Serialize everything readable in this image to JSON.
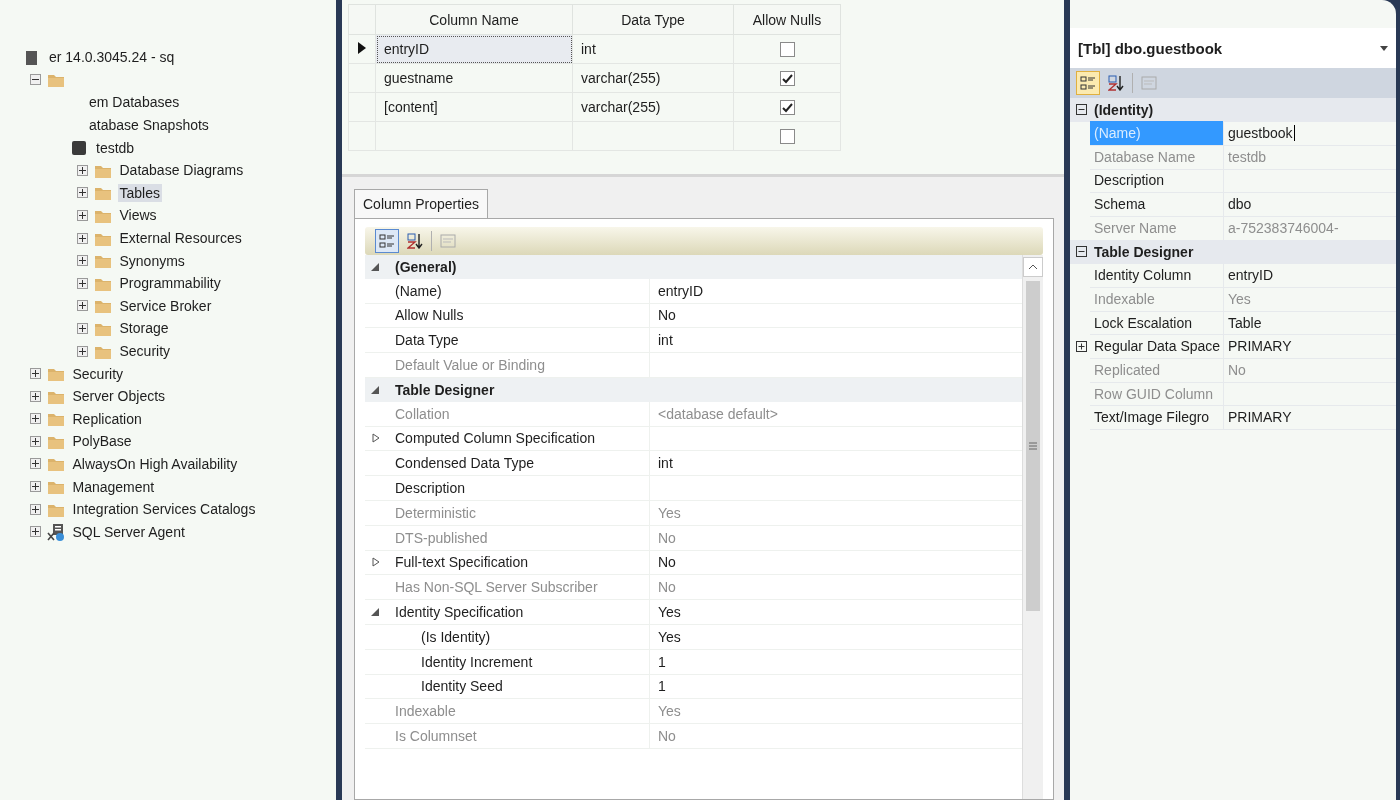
{
  "object_explorer": {
    "items": [
      {
        "label": "er 14.0.3045.24 - sq",
        "kind": "server",
        "selected": false,
        "children": [
          {
            "expanded": true,
            "children": [
              {
                "label": "em Databases",
                "kind": "plain",
                "selected": false
              },
              {
                "label": "atabase Snapshots",
                "kind": "plain",
                "selected": false
              },
              {
                "label": "testdb",
                "kind": "database",
                "selected": false,
                "children": [
                  {
                    "label": "Database Diagrams",
                    "expanded": false,
                    "selected": false
                  },
                  {
                    "label": "Tables",
                    "expanded": false,
                    "selected": true
                  },
                  {
                    "label": "Views",
                    "expanded": false,
                    "selected": false
                  },
                  {
                    "label": "External Resources",
                    "expanded": false,
                    "selected": false
                  },
                  {
                    "label": "Synonyms",
                    "expanded": false,
                    "selected": false
                  },
                  {
                    "label": "Programmability",
                    "expanded": false,
                    "selected": false
                  },
                  {
                    "label": "Service Broker",
                    "expanded": false,
                    "selected": false
                  },
                  {
                    "label": "Storage",
                    "expanded": false,
                    "selected": false
                  },
                  {
                    "label": "Security",
                    "expanded": false,
                    "selected": false
                  }
                ]
              }
            ]
          },
          {
            "label": "Security",
            "expanded": false,
            "selected": false
          },
          {
            "label": "Server Objects",
            "expanded": false,
            "selected": false
          },
          {
            "label": "Replication",
            "expanded": false,
            "selected": false
          },
          {
            "label": "PolyBase",
            "expanded": false,
            "selected": false
          },
          {
            "label": "AlwaysOn High Availability",
            "expanded": false,
            "selected": false
          },
          {
            "label": "Management",
            "expanded": false,
            "selected": false
          },
          {
            "label": "Integration Services Catalogs",
            "expanded": false,
            "selected": false
          },
          {
            "label": "SQL Server Agent",
            "kind": "agent",
            "expanded": false,
            "selected": false
          }
        ]
      }
    ]
  },
  "table_designer": {
    "columns": [
      "Column Name",
      "Data Type",
      "Allow Nulls"
    ],
    "rows": [
      {
        "name": "entryID",
        "type": "int",
        "allow_nulls": false,
        "current": true
      },
      {
        "name": "guestname",
        "type": "varchar(255)",
        "allow_nulls": true,
        "current": false
      },
      {
        "name": "[content]",
        "type": "varchar(255)",
        "allow_nulls": true,
        "current": false
      },
      {
        "allow_nulls": false,
        "current": false
      }
    ]
  },
  "column_properties": {
    "tab": "Column Properties",
    "toolbar": [
      {
        "kind": "categorized",
        "selected": true
      },
      {
        "kind": "alphabetical",
        "selected": false
      },
      {
        "kind": "pages",
        "selected": false
      }
    ],
    "categories": [
      {
        "name": "(General)",
        "expanded": true,
        "rows": [
          {
            "name": "(Name)",
            "value": "entryID",
            "disabled": false
          },
          {
            "name": "Allow Nulls",
            "value": "No",
            "disabled": false
          },
          {
            "name": "Data Type",
            "value": "int",
            "disabled": false
          },
          {
            "name": "Default Value or Binding",
            "disabled": true
          }
        ]
      },
      {
        "name": "Table Designer",
        "expanded": true,
        "rows": [
          {
            "name": "Collation",
            "value": "<database default>",
            "disabled": true
          },
          {
            "name": "Computed Column Specification",
            "disabled": false,
            "expanded": false
          },
          {
            "name": "Condensed Data Type",
            "value": "int",
            "disabled": false
          },
          {
            "name": "Description",
            "disabled": false
          },
          {
            "name": "Deterministic",
            "value": "Yes",
            "disabled": true
          },
          {
            "name": "DTS-published",
            "value": "No",
            "disabled": true
          },
          {
            "name": "Full-text Specification",
            "value": "No",
            "disabled": false,
            "expanded": false
          },
          {
            "name": "Has Non-SQL Server Subscriber",
            "value": "No",
            "disabled": true
          },
          {
            "name": "Identity Specification",
            "value": "Yes",
            "disabled": false,
            "expanded": true,
            "children": [
              {
                "name": "(Is Identity)",
                "value": "Yes",
                "disabled": false
              },
              {
                "name": "Identity Increment",
                "value": "1",
                "disabled": false
              },
              {
                "name": "Identity Seed",
                "value": "1",
                "disabled": false
              }
            ]
          },
          {
            "name": "Indexable",
            "value": "Yes",
            "disabled": true
          },
          {
            "name": "Is Columnset",
            "value": "No",
            "disabled": true
          }
        ]
      }
    ]
  },
  "properties": {
    "object": "[Tbl] dbo.guestbook",
    "toolbar": [
      {
        "kind": "categorized",
        "selected": true
      },
      {
        "kind": "alphabetical",
        "selected": false
      },
      {
        "kind": "pages",
        "selected": false
      }
    ],
    "categories": [
      {
        "name": "(Identity)",
        "expanded": true,
        "rows": [
          {
            "name": "(Name)",
            "value": "guestbook",
            "disabled": false,
            "selected": true
          },
          {
            "name": "Database Name",
            "value": "testdb",
            "disabled": true,
            "selected": false
          },
          {
            "name": "Description",
            "disabled": false,
            "selected": false
          },
          {
            "name": "Schema",
            "value": "dbo",
            "disabled": false,
            "selected": false
          },
          {
            "name": "Server Name",
            "value": "a-752383746004-",
            "disabled": true,
            "selected": false
          }
        ]
      },
      {
        "name": "Table Designer",
        "expanded": true,
        "rows": [
          {
            "name": "Identity Column",
            "value": "entryID",
            "disabled": false,
            "selected": false
          },
          {
            "name": "Indexable",
            "value": "Yes",
            "disabled": true,
            "selected": false
          },
          {
            "name": "Lock Escalation",
            "value": "Table",
            "disabled": false,
            "selected": false
          },
          {
            "name": "Regular Data Space",
            "value": "PRIMARY",
            "disabled": false,
            "selected": false,
            "expanded": false
          },
          {
            "name": "Replicated",
            "value": "No",
            "disabled": true,
            "selected": false
          },
          {
            "name": "Row GUID Column",
            "disabled": true,
            "selected": false
          },
          {
            "name": "Text/Image Filegro",
            "value": "PRIMARY",
            "disabled": false,
            "selected": false
          }
        ]
      }
    ]
  }
}
